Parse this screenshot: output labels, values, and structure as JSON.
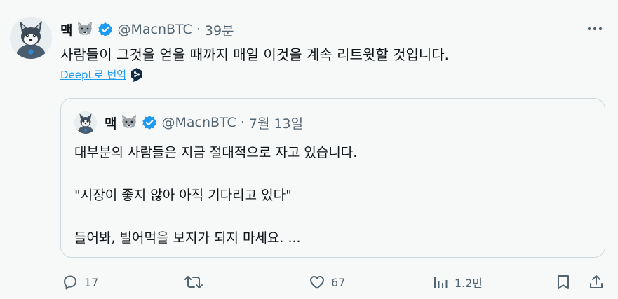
{
  "tweet": {
    "author_name": "맥",
    "author_emoji": "wolf-emoji",
    "handle": "@MacnBTC",
    "separator": "·",
    "time": "39분",
    "text": "사람들이 그것을 얻을 때까지 매일 이것을 계속 리트윗할 것입니다.",
    "translate_label": "DeepL로 번역"
  },
  "quote": {
    "author_name": "맥",
    "handle": "@MacnBTC",
    "separator": "·",
    "time": "7월 13일",
    "lines": [
      "대부분의 사람들은 지금 절대적으로 자고 있습니다.",
      "\"시장이 좋지 않아 아직 기다리고 있다\"",
      "들어봐, 빌어먹을 보지가 되지 마세요. ..."
    ]
  },
  "actions": {
    "reply_count": "17",
    "retweet_count": "",
    "like_count": "67",
    "views_count": "1.2만"
  },
  "colors": {
    "background": "#f7f9f9",
    "verified": "#1d9bf0",
    "link": "#1d9bf0",
    "muted": "#536471",
    "text": "#0f1419",
    "border": "#cfd9de"
  },
  "icons": [
    "wolf-emoji",
    "verified-badge-icon",
    "more-icon",
    "deepl-icon",
    "reply-icon",
    "retweet-icon",
    "like-icon",
    "views-icon",
    "bookmark-icon",
    "share-icon"
  ]
}
